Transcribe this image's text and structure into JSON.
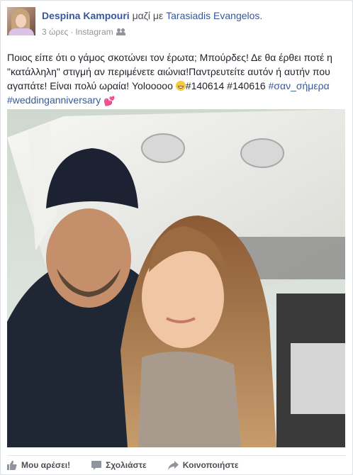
{
  "post": {
    "author": "Despina Kampouri",
    "with_word": "μαζί με",
    "tagged_person": "Tarasiadis Evangelos.",
    "time": "3 ώρες",
    "separator": "·",
    "source": "Instagram",
    "audience_icon": "friends-icon",
    "text": {
      "part1": "Ποιος είπε ότι ο γάμος σκοτώνει τον έρωτα; Μπούρδες! Δε θα έρθει ποτέ η \"κατάλληλη\" στιγμή αν περιμένετε αιώνια!Παντρευτείτε αυτόν ή αυτήν που αγαπάτε! Είναι πολύ ωραία! Yolooooo",
      "part2": "#140614 #140616",
      "tag1": "#σαν_σήμερα",
      "tag2": "#weddinganniversary",
      "emoji1": "grinning-face-emoji",
      "emoji2": "💕"
    },
    "photo": {
      "subject": "photo"
    }
  },
  "actions": {
    "like": "Μου αρέσει!",
    "comment": "Σχολιάστε",
    "share": "Κοινοποιήστε"
  },
  "colors": {
    "link": "#365899",
    "text": "#1d2129",
    "meta": "#90949c",
    "action": "#4b4f56"
  }
}
